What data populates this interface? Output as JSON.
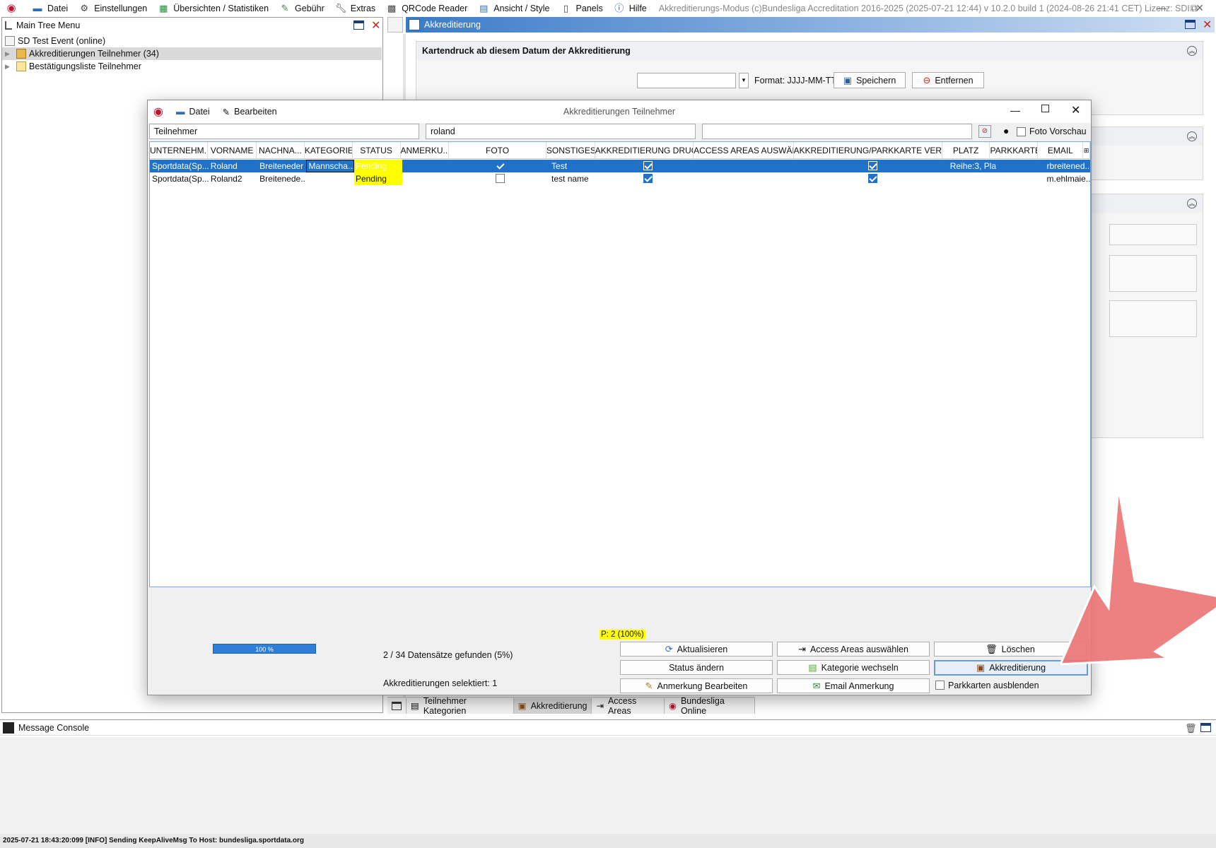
{
  "menubar": {
    "items": [
      "Datei",
      "Einstellungen",
      "Übersichten / Statistiken",
      "Gebühr",
      "Extras",
      "QRCode Reader",
      "Ansicht / Style",
      "Panels",
      "Hilfe"
    ],
    "app_title": "Akkreditierungs-Modus (c)Bundesliga Accreditation 2016-2025 (2025-07-21 12:44) v 10.2.0 build 1 (2024-08-26 21:41 CET) Lizenz: SDI..."
  },
  "tree_panel": {
    "title": "Main Tree Menu",
    "root": "SD Test Event (online)",
    "items": [
      "Akkreditierungen Teilnehmer (34)",
      "Bestätigungsliste Teilnehmer"
    ]
  },
  "acc_panel": {
    "title": "Akkreditierung",
    "section_title": "Kartendruck ab diesem Datum der Akkreditierung",
    "date_value": "",
    "format_label": "Format: JJJJ-MM-TT",
    "save_label": "Speichern",
    "remove_label": "Entfernen"
  },
  "dialog": {
    "title": "Akkreditierungen Teilnehmer",
    "menu": [
      "Datei",
      "Bearbeiten"
    ],
    "filter1": "Teilnehmer",
    "filter2": "roland",
    "filter3": "",
    "foto_vorschau": "Foto Vorschau",
    "columns": [
      "UNTERNEHM...",
      "VORNAME",
      "NACHNA...",
      "KATEGORIE",
      "STATUS",
      "ANMERKU...",
      "FOTO",
      "SONSTIGES",
      "AKKREDITIERUNG DRUC...",
      "ACCESS AREAS AUSWÄH...",
      "AKKREDITIERUNG/PARKKARTE VERSCH...",
      "PLATZ",
      "PARKKARTE",
      "EMAIL"
    ],
    "rows": [
      {
        "unternehmen": "Sportdata(Sp...",
        "vorname": "Roland",
        "nachname": "Breiteneder",
        "kategorie": "Mannscha...",
        "status": "Pending",
        "anmerkung": "",
        "foto": true,
        "sonstiges": "Test",
        "druck": true,
        "access": "",
        "versch": true,
        "platz": "Reihe:3, Pla...",
        "parkkarte": "",
        "email": "rbreitened..."
      },
      {
        "unternehmen": "Sportdata(Sp...",
        "vorname": "Roland2",
        "nachname": "Breitenede...",
        "kategorie": "",
        "status": "Pending",
        "anmerkung": "",
        "foto": false,
        "sonstiges": "test name",
        "druck": true,
        "access": "",
        "versch": true,
        "platz": "",
        "parkkarte": "",
        "email": "m.ehlmaie..."
      }
    ],
    "p_count": "P: 2 (100%)",
    "progress_label": "100 %",
    "progress_value": 1.0,
    "records_found": "2 / 34 Datensätze gefunden (5%)",
    "selected": "Akkreditierungen selektiert: 1",
    "buttons": {
      "aktualisieren": "Aktualisieren",
      "access_areas": "Access Areas auswählen",
      "loeschen": "Löschen",
      "status_aendern": "Status ändern",
      "kategorie_wechseln": "Kategorie wechseln",
      "akkreditierung": "Akkreditierung",
      "anmerkung_bearbeiten": "Anmerkung Bearbeiten",
      "email_anmerkung": "Email Anmerkung",
      "parkkarten_ausblenden": "Parkkarten ausblenden"
    }
  },
  "bottom_tabs": [
    "Teilnehmer Kategorien",
    "Akkreditierung",
    "Access Areas",
    "Bundesliga Online"
  ],
  "console": {
    "title": "Message Console"
  },
  "status_line": "2025-07-21 18:43:20:099 [INFO] Sending KeepAliveMsg To Host: bundesliga.sportdata.org",
  "colors": {
    "accent": "#1f72c8",
    "pending": "#ffff00",
    "brand_red": "#c8102e",
    "arrow": "#ec7575"
  }
}
